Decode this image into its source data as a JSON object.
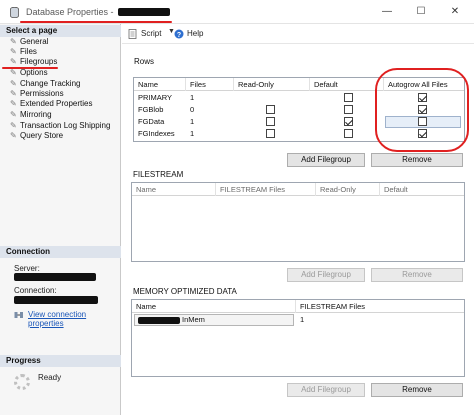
{
  "window": {
    "title": "Database Properties - ",
    "controls": {
      "minimize": "—",
      "maximize": "☐",
      "close": "✕"
    }
  },
  "left": {
    "select_page_header": "Select a page",
    "pages": [
      "General",
      "Files",
      "Filegroups",
      "Options",
      "Change Tracking",
      "Permissions",
      "Extended Properties",
      "Mirroring",
      "Transaction Log Shipping",
      "Query Store"
    ],
    "connection_header": "Connection",
    "server_label": "Server:",
    "connection_label": "Connection:",
    "view_connection_link": "View connection properties",
    "progress_header": "Progress",
    "progress_status": "Ready"
  },
  "toolbar": {
    "script_label": "Script",
    "help_label": "Help"
  },
  "rows_section": {
    "label": "Rows",
    "columns": [
      "Name",
      "Files",
      "Read-Only",
      "Default",
      "Autogrow All Files"
    ],
    "rows": [
      {
        "name": "PRIMARY",
        "files": "1",
        "read_only": null,
        "default": false,
        "autogrow": true
      },
      {
        "name": "FGBlob",
        "files": "0",
        "read_only": false,
        "default": false,
        "autogrow": true
      },
      {
        "name": "FGData",
        "files": "1",
        "read_only": false,
        "default": true,
        "autogrow": false
      },
      {
        "name": "FGIndexes",
        "files": "1",
        "read_only": false,
        "default": false,
        "autogrow": true
      }
    ],
    "add_button": "Add Filegroup",
    "remove_button": "Remove"
  },
  "filestream_section": {
    "label": "FILESTREAM",
    "columns": [
      "Name",
      "FILESTREAM Files",
      "Read-Only",
      "Default"
    ],
    "add_button": "Add Filegroup",
    "remove_button": "Remove"
  },
  "memory_section": {
    "label": "MEMORY OPTIMIZED DATA",
    "columns": [
      "Name",
      "FILESTREAM Files"
    ],
    "rows": [
      {
        "name_suffix": "InMem",
        "files": "1"
      }
    ],
    "add_button": "Add Filegroup",
    "remove_button": "Remove"
  },
  "colors": {
    "annotation": "#e02020",
    "section_header_bg": "#dde3ec",
    "link": "#1a56b8"
  }
}
